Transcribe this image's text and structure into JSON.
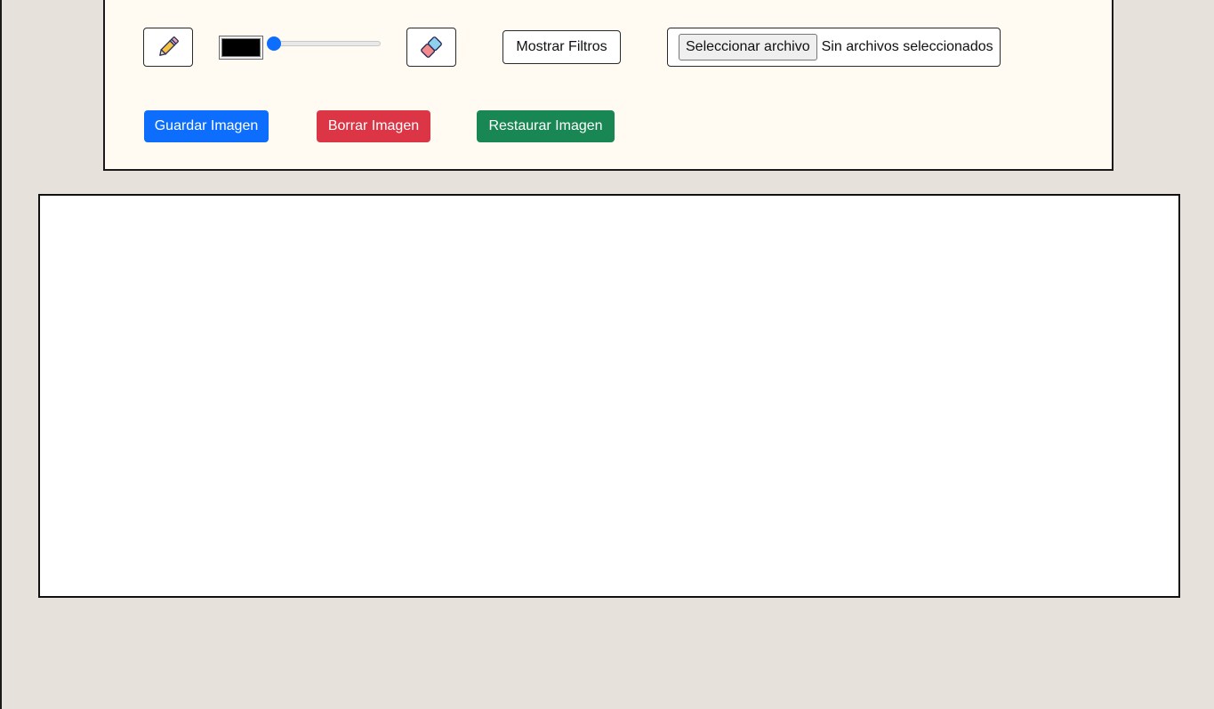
{
  "toolbar": {
    "pencil_icon": "pencil-icon",
    "eraser_icon": "eraser-icon",
    "stroke_color": "#000000",
    "brush_size": {
      "value": 1,
      "min": 1,
      "max": 100
    },
    "filters_label": "Mostrar Filtros",
    "file_input": {
      "button_label": "Seleccionar archivo",
      "status": "Sin archivos seleccionados"
    }
  },
  "actions": {
    "save": {
      "label": "Guardar Imagen",
      "color": "#0d6efd"
    },
    "clear": {
      "label": "Borrar Imagen",
      "color": "#dc3545"
    },
    "restore": {
      "label": "Restaurar Imagen",
      "color": "#198754"
    }
  },
  "colors": {
    "page_background": "#e6e1db",
    "panel_background": "#fffbf2",
    "canvas_background": "#ffffff",
    "slider_accent": "#0d6efd"
  }
}
